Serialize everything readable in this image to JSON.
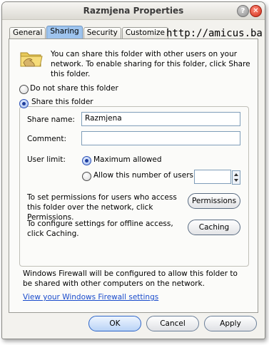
{
  "window": {
    "title": "Razmjena Properties",
    "help_glyph": "?",
    "close_glyph": "✕"
  },
  "tabs": [
    {
      "label": "General"
    },
    {
      "label": "Sharing"
    },
    {
      "label": "Security"
    },
    {
      "label": "Customize"
    }
  ],
  "watermark": "http://amicus.ba",
  "sharing": {
    "intro": "You can share this folder with other users on your network.  To enable sharing for this folder, click Share this folder.",
    "do_not_share_label": "Do not share this folder",
    "share_label": "Share this folder",
    "share_name_label": "Share name:",
    "share_name_value": "Razmjena",
    "comment_label": "Comment:",
    "comment_value": "",
    "user_limit_label": "User limit:",
    "max_allowed_label": "Maximum allowed",
    "allow_number_label": "Allow this number of users:",
    "allow_number_value": "",
    "permissions_text": "To set permissions for users who access this folder over the network, click Permissions.",
    "permissions_button": "Permissions",
    "caching_text": "To configure settings for offline access, click Caching.",
    "caching_button": "Caching",
    "firewall_text": "Windows Firewall will be configured to allow this folder to be shared with other computers on the network.",
    "firewall_link": "View your Windows Firewall settings"
  },
  "footer": {
    "ok": "OK",
    "cancel": "Cancel",
    "apply": "Apply"
  },
  "colors": {
    "active_tab": "#9ec4ee",
    "link": "#1a4ccc",
    "selected_radio": "#1f3e9e"
  }
}
